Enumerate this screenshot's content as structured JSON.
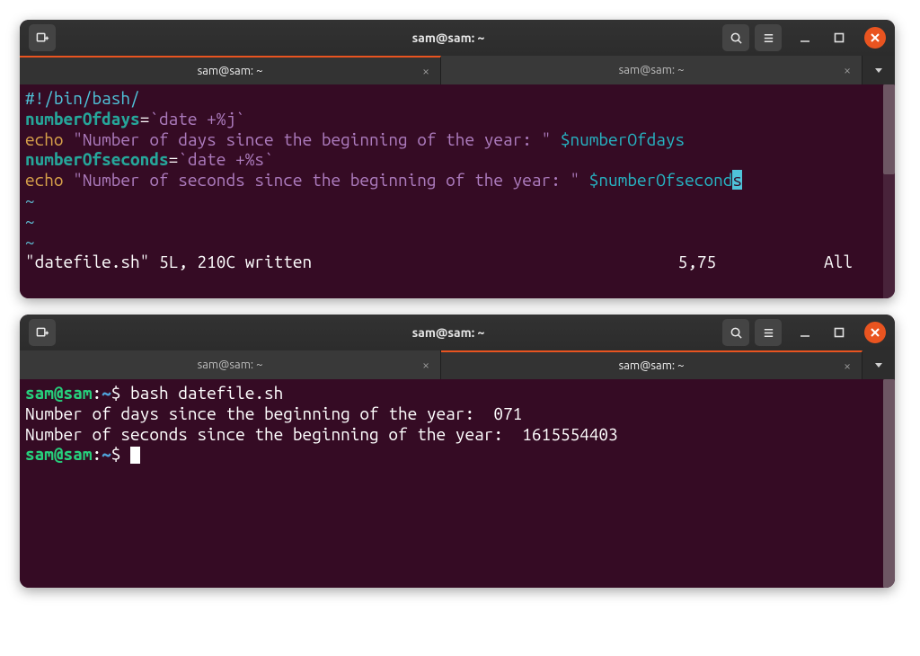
{
  "windows": [
    {
      "title": "sam@sam: ~",
      "tabs": [
        {
          "label": "sam@sam: ~",
          "active": true
        },
        {
          "label": "sam@sam: ~",
          "active": false
        }
      ],
      "editor": {
        "shebang": "#!/bin/bash/",
        "assign1_var": "numberOfdays",
        "assign1_eq": "=",
        "assign1_cmd": "`date +%j`",
        "echo2_kw": "echo ",
        "echo2_str": "\"Number of days since the beginning of the year: \" ",
        "echo2_var": "$numberOfdays",
        "assign3_var": "numberOfseconds",
        "assign3_eq": "=",
        "assign3_cmd": "`date +%s`",
        "echo4_kw": "echo ",
        "echo4_str": "\"Number of seconds since the beginning of the year: \" ",
        "echo4_var_head": "$numberOfsecond",
        "echo4_var_tail": "s",
        "tilde": "~"
      },
      "vim_status": {
        "left": "\"datefile.sh\" 5L, 210C written",
        "pos": "5,75",
        "right": "All"
      }
    },
    {
      "title": "sam@sam: ~",
      "tabs": [
        {
          "label": "sam@sam: ~",
          "active": false
        },
        {
          "label": "sam@sam: ~",
          "active": true
        }
      ],
      "shell": {
        "p1_user": "sam@sam",
        "p1_colon": ":",
        "p1_path": "~",
        "p1_dollar": "$ ",
        "p1_cmd": "bash datefile.sh",
        "out1": "Number of days since the beginning of the year:  071",
        "out2": "Number of seconds since the beginning of the year:  1615554403",
        "p2_user": "sam@sam",
        "p2_colon": ":",
        "p2_path": "~",
        "p2_dollar": "$ "
      }
    }
  ]
}
